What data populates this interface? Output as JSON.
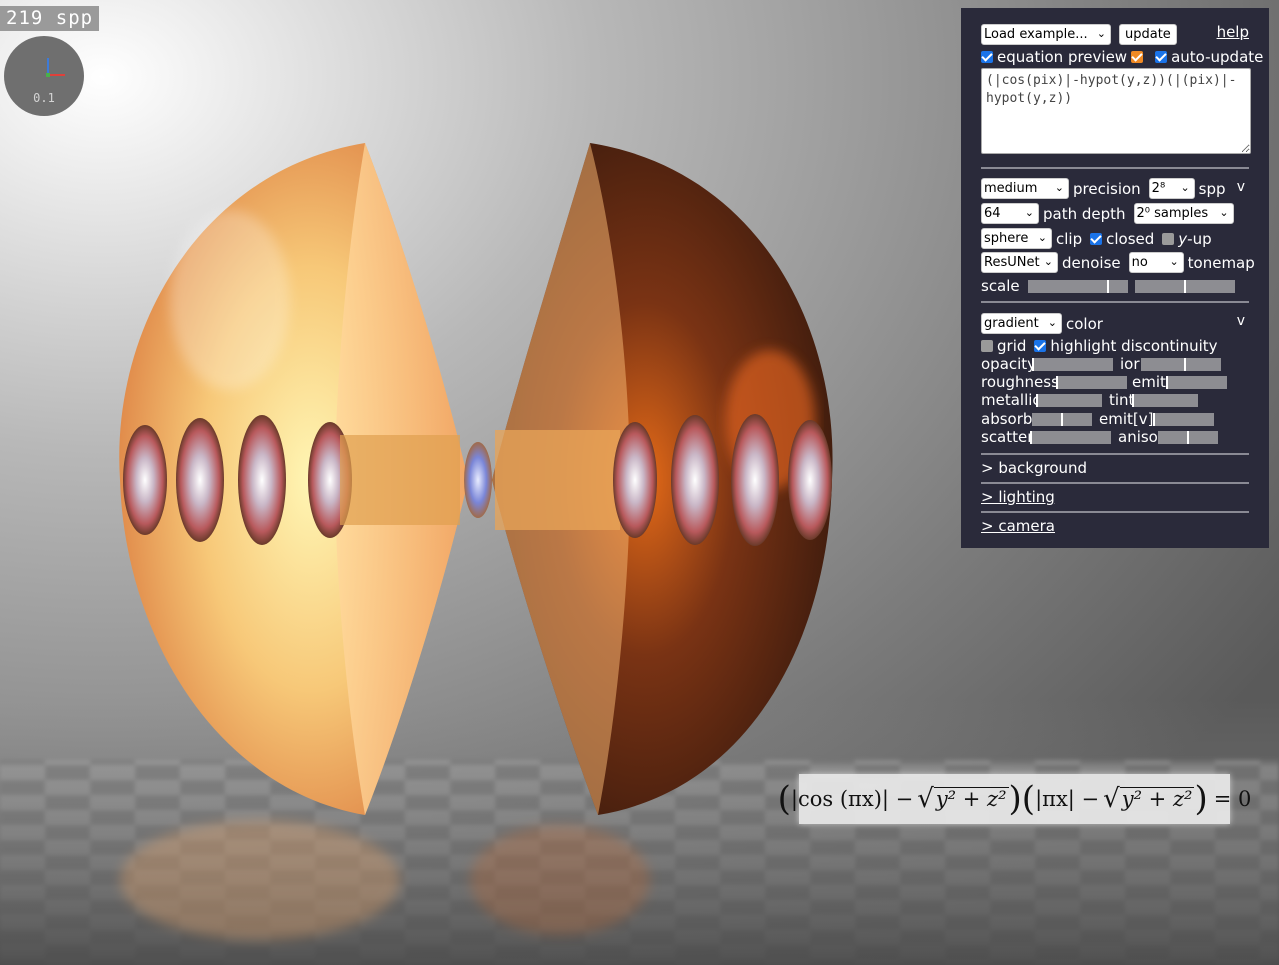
{
  "spp_counter": "219 spp",
  "gizmo": {
    "value": "0.1"
  },
  "equation_display": {
    "text": "(|cos (πx)| − √(y² + z²)) (|πx| − √(y² + z²)) = 0",
    "part_cos": "|cos (πx)| −",
    "part_pix": "|πx| −",
    "sqrt_body": "y² + z²",
    "rhs": "= 0"
  },
  "panel": {
    "load_example": "Load example...",
    "update_label": "update",
    "help_label": "help",
    "equation_preview_label": "equation preview",
    "auto_update_label": "auto-update",
    "equation_input": "(|cos(pix)|-hypot(y,z))(|(pix)|-hypot(y,z))",
    "precision_value": "medium",
    "precision_label": "precision",
    "spp_value": "2⁸",
    "spp_label": "spp",
    "collapse_1": "v",
    "path_depth_value": "64",
    "path_depth_label": "path depth",
    "samples_value": "2⁰ samples",
    "clip_value": "sphere",
    "clip_label": "clip",
    "closed_label": "closed",
    "yup_label_y": "y",
    "yup_label_rest": "-up",
    "denoise_value": "ResUNet",
    "denoise_label": "denoise",
    "tonemap_value": "no",
    "tonemap_label": "tonemap",
    "scale_label": "scale",
    "scale_slider_1": 0.8,
    "scale_slider_2": 0.5,
    "color_value": "gradient",
    "color_label": "color",
    "collapse_2": "v",
    "grid_label": "grid",
    "highlight_label": "highlight discontinuity",
    "opacity_label": "opacity",
    "opacity": 0.0,
    "ior_label": "ior",
    "ior": 0.55,
    "roughness_label": "roughness",
    "roughness": 0.0,
    "emit_label": "emit",
    "emit": 0.0,
    "metallic_label": "metallic",
    "metallic": 0.0,
    "tint_label": "tint",
    "tint": 0.0,
    "absorb_label": "absorb",
    "absorb": 0.5,
    "emitv_label": "emit[v]",
    "emitv": 0.0,
    "scatter_label": "scatter",
    "scatter": 0.0,
    "aniso_label": "aniso",
    "aniso": 0.5,
    "background_section": "> background",
    "lighting_section": "> lighting",
    "camera_section": "> camera"
  },
  "colors": {
    "panel_bg": "#2a2a3a",
    "checkbox_on": "#1a73e8",
    "preview_swatch": "#f08a24"
  }
}
